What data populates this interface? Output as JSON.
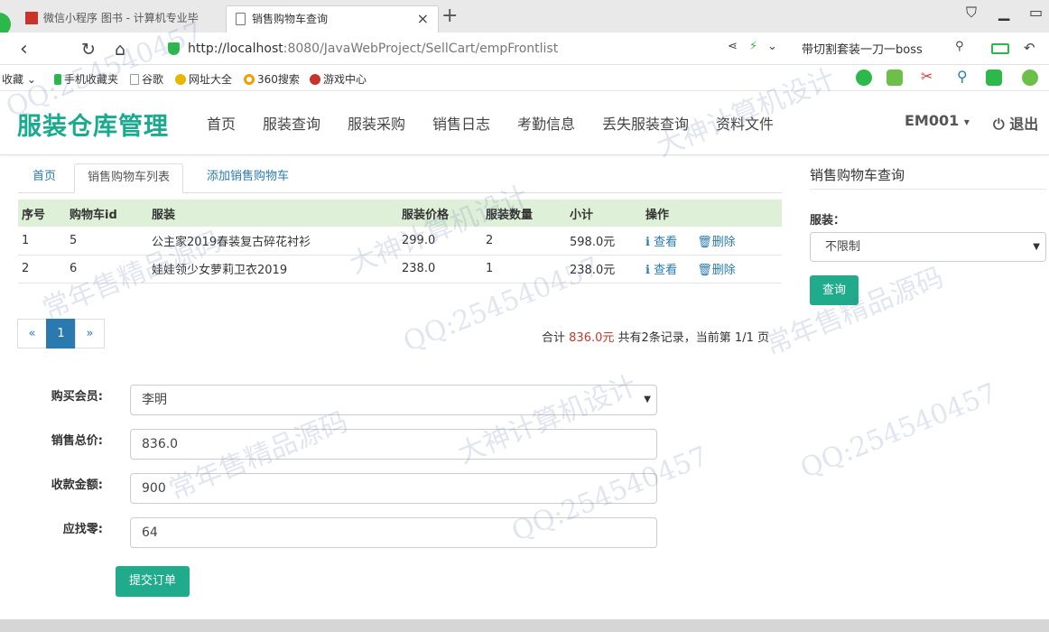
{
  "browser": {
    "tabs": [
      {
        "title": "微信小程序 图书 - 计算机专业毕"
      },
      {
        "title": "销售购物车查询",
        "close": "×"
      }
    ],
    "new_tab": "+",
    "url_host": "http://localhost",
    "url_path": ":8080/JavaWebProject/SellCart/empFrontlist",
    "search_text": "带切割套装一刀一boss",
    "bookmarks": [
      "收藏",
      "手机收藏夹",
      "谷歌",
      "网址大全",
      "360搜索",
      "游戏中心"
    ]
  },
  "app": {
    "brand": "服装仓库管理",
    "nav": [
      "首页",
      "服装查询",
      "服装采购",
      "销售日志",
      "考勤信息",
      "丢失服装查询",
      "资料文件"
    ],
    "user": "EM001",
    "user_caret": "▾",
    "logout": "退出",
    "logout_icon": "⏻"
  },
  "tabs": {
    "home": "首页",
    "list": "销售购物车列表",
    "add": "添加销售购物车"
  },
  "table": {
    "headers": [
      "序号",
      "购物车id",
      "服装",
      "服装价格",
      "服装数量",
      "小计",
      "操作"
    ],
    "rows": [
      {
        "no": "1",
        "id": "5",
        "item": "公主家2019春装复古碎花衬衫",
        "price": "299.0",
        "qty": "2",
        "subtotal": "598.0元"
      },
      {
        "no": "2",
        "id": "6",
        "item": "娃娃领少女萝莉卫衣2019",
        "price": "238.0",
        "qty": "1",
        "subtotal": "238.0元"
      }
    ],
    "view_label": "查看",
    "delete_label": "删除"
  },
  "pager": {
    "prev": "«",
    "current": "1",
    "next": "»"
  },
  "summary": {
    "prefix": "合计",
    "amount": "836.0元",
    "suffix": "共有2条记录，当前第 1/1 页"
  },
  "form": {
    "member_label": "购买会员:",
    "member_value": "李明",
    "total_label": "销售总价:",
    "total_value": "836.0",
    "paid_label": "收款金额:",
    "paid_value": "900",
    "change_label": "应找零:",
    "change_value": "64",
    "submit": "提交订单"
  },
  "query_panel": {
    "title": "销售购物车查询",
    "label": "服装：",
    "select_value": "不限制",
    "button": "查询"
  },
  "watermark": [
    "QQ:254540457",
    "大神计算机设计",
    "常年售精品源码",
    "QQ:254540457",
    "大神计算机设计",
    "常年售精品源码",
    "QQ:254540457",
    "常年售精品源码",
    "大神计算机设计",
    "QQ:254540457"
  ],
  "colors": {
    "accent": "#1aaa8f",
    "link": "#2a7ab0",
    "table_header": "#dff0d8",
    "amount": "#c0392b"
  }
}
